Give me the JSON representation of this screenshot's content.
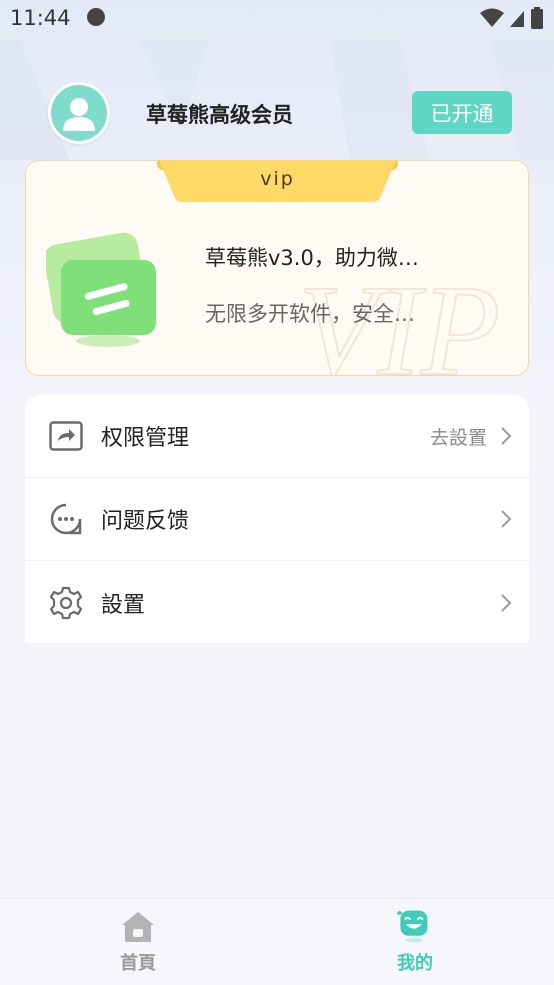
{
  "status_bar": {
    "time": "11:44"
  },
  "profile": {
    "name": "草莓熊高级会员",
    "status": "已开通"
  },
  "vip_card": {
    "tab_label": "vip",
    "title": "草莓熊v3.0，助力微…",
    "subtitle": "无限多开软件，安全…",
    "watermark": "VIP"
  },
  "menu": {
    "items": [
      {
        "label": "权限管理",
        "hint": "去設置",
        "icon": "share-square-icon"
      },
      {
        "label": "问题反馈",
        "hint": "",
        "icon": "chat-bubble-icon"
      },
      {
        "label": "設置",
        "hint": "",
        "icon": "gear-icon"
      }
    ]
  },
  "tabbar": {
    "home_label": "首頁",
    "mine_label": "我的"
  },
  "colors": {
    "accent": "#5ed6c4",
    "tab_active": "#3fcbb7",
    "card_border": "#f1d9a6",
    "card_tab": "#ffd966"
  }
}
